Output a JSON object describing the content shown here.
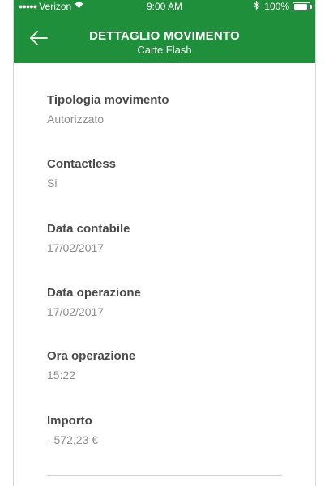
{
  "status_bar": {
    "signal": "●●●●●",
    "carrier": "Verizon",
    "time": "9:00 AM",
    "battery": "100%",
    "battery_level": 1.0
  },
  "header": {
    "back_icon": "back-arrow-icon",
    "title": "DETTAGLIO MOVIMENTO",
    "subtitle": "Carte Flash"
  },
  "details": [
    {
      "label": "Tipologia movimento",
      "value": "Autorizzato"
    },
    {
      "label": "Contactless",
      "value": "Si"
    },
    {
      "label": "Data contabile",
      "value": "17/02/2017"
    },
    {
      "label": "Data operazione",
      "value": "17/02/2017"
    },
    {
      "label": "Ora operazione",
      "value": "15:22"
    },
    {
      "label": "Importo",
      "value": "- 572,23 €"
    }
  ],
  "colors": {
    "header_bg": "#1f8f3b",
    "label": "#4a4a4a",
    "value": "#8e8e8e"
  }
}
